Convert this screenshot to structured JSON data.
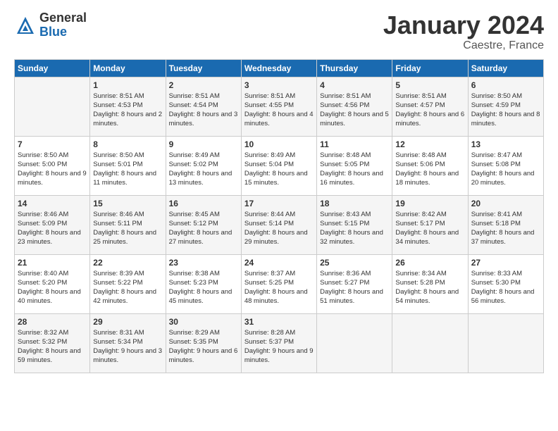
{
  "logo": {
    "general": "General",
    "blue": "Blue"
  },
  "title": "January 2024",
  "location": "Caestre, France",
  "days_of_week": [
    "Sunday",
    "Monday",
    "Tuesday",
    "Wednesday",
    "Thursday",
    "Friday",
    "Saturday"
  ],
  "weeks": [
    [
      {
        "day": "",
        "sunrise": "",
        "sunset": "",
        "daylight": ""
      },
      {
        "day": "1",
        "sunrise": "Sunrise: 8:51 AM",
        "sunset": "Sunset: 4:53 PM",
        "daylight": "Daylight: 8 hours and 2 minutes."
      },
      {
        "day": "2",
        "sunrise": "Sunrise: 8:51 AM",
        "sunset": "Sunset: 4:54 PM",
        "daylight": "Daylight: 8 hours and 3 minutes."
      },
      {
        "day": "3",
        "sunrise": "Sunrise: 8:51 AM",
        "sunset": "Sunset: 4:55 PM",
        "daylight": "Daylight: 8 hours and 4 minutes."
      },
      {
        "day": "4",
        "sunrise": "Sunrise: 8:51 AM",
        "sunset": "Sunset: 4:56 PM",
        "daylight": "Daylight: 8 hours and 5 minutes."
      },
      {
        "day": "5",
        "sunrise": "Sunrise: 8:51 AM",
        "sunset": "Sunset: 4:57 PM",
        "daylight": "Daylight: 8 hours and 6 minutes."
      },
      {
        "day": "6",
        "sunrise": "Sunrise: 8:50 AM",
        "sunset": "Sunset: 4:59 PM",
        "daylight": "Daylight: 8 hours and 8 minutes."
      }
    ],
    [
      {
        "day": "7",
        "sunrise": "Sunrise: 8:50 AM",
        "sunset": "Sunset: 5:00 PM",
        "daylight": "Daylight: 8 hours and 9 minutes."
      },
      {
        "day": "8",
        "sunrise": "Sunrise: 8:50 AM",
        "sunset": "Sunset: 5:01 PM",
        "daylight": "Daylight: 8 hours and 11 minutes."
      },
      {
        "day": "9",
        "sunrise": "Sunrise: 8:49 AM",
        "sunset": "Sunset: 5:02 PM",
        "daylight": "Daylight: 8 hours and 13 minutes."
      },
      {
        "day": "10",
        "sunrise": "Sunrise: 8:49 AM",
        "sunset": "Sunset: 5:04 PM",
        "daylight": "Daylight: 8 hours and 15 minutes."
      },
      {
        "day": "11",
        "sunrise": "Sunrise: 8:48 AM",
        "sunset": "Sunset: 5:05 PM",
        "daylight": "Daylight: 8 hours and 16 minutes."
      },
      {
        "day": "12",
        "sunrise": "Sunrise: 8:48 AM",
        "sunset": "Sunset: 5:06 PM",
        "daylight": "Daylight: 8 hours and 18 minutes."
      },
      {
        "day": "13",
        "sunrise": "Sunrise: 8:47 AM",
        "sunset": "Sunset: 5:08 PM",
        "daylight": "Daylight: 8 hours and 20 minutes."
      }
    ],
    [
      {
        "day": "14",
        "sunrise": "Sunrise: 8:46 AM",
        "sunset": "Sunset: 5:09 PM",
        "daylight": "Daylight: 8 hours and 23 minutes."
      },
      {
        "day": "15",
        "sunrise": "Sunrise: 8:46 AM",
        "sunset": "Sunset: 5:11 PM",
        "daylight": "Daylight: 8 hours and 25 minutes."
      },
      {
        "day": "16",
        "sunrise": "Sunrise: 8:45 AM",
        "sunset": "Sunset: 5:12 PM",
        "daylight": "Daylight: 8 hours and 27 minutes."
      },
      {
        "day": "17",
        "sunrise": "Sunrise: 8:44 AM",
        "sunset": "Sunset: 5:14 PM",
        "daylight": "Daylight: 8 hours and 29 minutes."
      },
      {
        "day": "18",
        "sunrise": "Sunrise: 8:43 AM",
        "sunset": "Sunset: 5:15 PM",
        "daylight": "Daylight: 8 hours and 32 minutes."
      },
      {
        "day": "19",
        "sunrise": "Sunrise: 8:42 AM",
        "sunset": "Sunset: 5:17 PM",
        "daylight": "Daylight: 8 hours and 34 minutes."
      },
      {
        "day": "20",
        "sunrise": "Sunrise: 8:41 AM",
        "sunset": "Sunset: 5:18 PM",
        "daylight": "Daylight: 8 hours and 37 minutes."
      }
    ],
    [
      {
        "day": "21",
        "sunrise": "Sunrise: 8:40 AM",
        "sunset": "Sunset: 5:20 PM",
        "daylight": "Daylight: 8 hours and 40 minutes."
      },
      {
        "day": "22",
        "sunrise": "Sunrise: 8:39 AM",
        "sunset": "Sunset: 5:22 PM",
        "daylight": "Daylight: 8 hours and 42 minutes."
      },
      {
        "day": "23",
        "sunrise": "Sunrise: 8:38 AM",
        "sunset": "Sunset: 5:23 PM",
        "daylight": "Daylight: 8 hours and 45 minutes."
      },
      {
        "day": "24",
        "sunrise": "Sunrise: 8:37 AM",
        "sunset": "Sunset: 5:25 PM",
        "daylight": "Daylight: 8 hours and 48 minutes."
      },
      {
        "day": "25",
        "sunrise": "Sunrise: 8:36 AM",
        "sunset": "Sunset: 5:27 PM",
        "daylight": "Daylight: 8 hours and 51 minutes."
      },
      {
        "day": "26",
        "sunrise": "Sunrise: 8:34 AM",
        "sunset": "Sunset: 5:28 PM",
        "daylight": "Daylight: 8 hours and 54 minutes."
      },
      {
        "day": "27",
        "sunrise": "Sunrise: 8:33 AM",
        "sunset": "Sunset: 5:30 PM",
        "daylight": "Daylight: 8 hours and 56 minutes."
      }
    ],
    [
      {
        "day": "28",
        "sunrise": "Sunrise: 8:32 AM",
        "sunset": "Sunset: 5:32 PM",
        "daylight": "Daylight: 8 hours and 59 minutes."
      },
      {
        "day": "29",
        "sunrise": "Sunrise: 8:31 AM",
        "sunset": "Sunset: 5:34 PM",
        "daylight": "Daylight: 9 hours and 3 minutes."
      },
      {
        "day": "30",
        "sunrise": "Sunrise: 8:29 AM",
        "sunset": "Sunset: 5:35 PM",
        "daylight": "Daylight: 9 hours and 6 minutes."
      },
      {
        "day": "31",
        "sunrise": "Sunrise: 8:28 AM",
        "sunset": "Sunset: 5:37 PM",
        "daylight": "Daylight: 9 hours and 9 minutes."
      },
      {
        "day": "",
        "sunrise": "",
        "sunset": "",
        "daylight": ""
      },
      {
        "day": "",
        "sunrise": "",
        "sunset": "",
        "daylight": ""
      },
      {
        "day": "",
        "sunrise": "",
        "sunset": "",
        "daylight": ""
      }
    ]
  ]
}
